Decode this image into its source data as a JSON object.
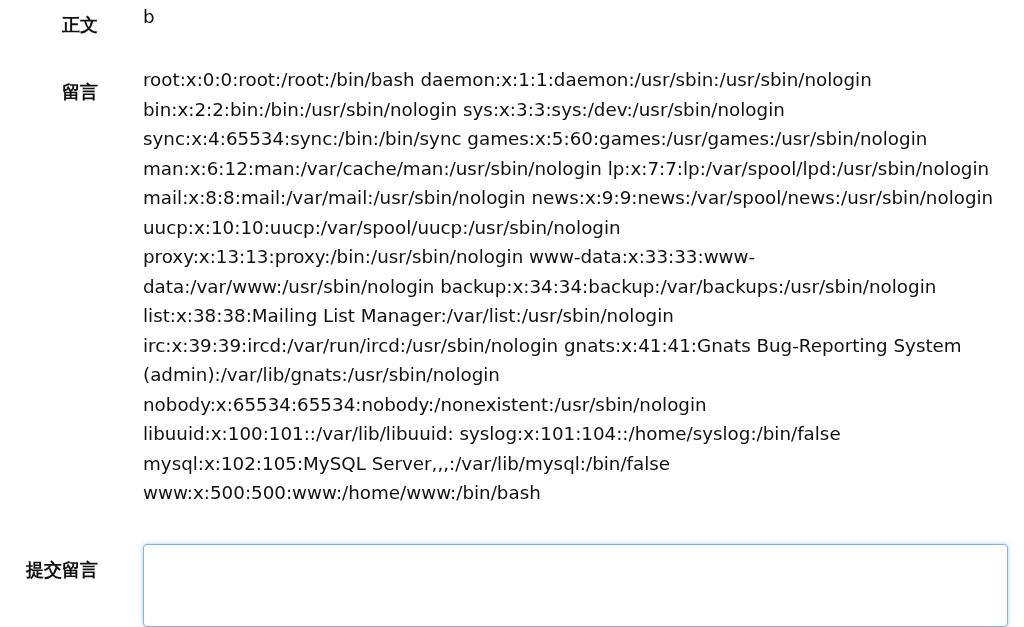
{
  "post": {
    "label": "正文",
    "body": "b"
  },
  "comments": {
    "label": "留言",
    "lines": [
      "root:x:0:0:root:/root:/bin/bash daemon:x:1:1:daemon:/usr/sbin:/usr/sbin/nologin",
      "bin:x:2:2:bin:/bin:/usr/sbin/nologin sys:x:3:3:sys:/dev:/usr/sbin/nologin",
      "sync:x:4:65534:sync:/bin:/bin/sync games:x:5:60:games:/usr/games:/usr/sbin/nologin",
      "man:x:6:12:man:/var/cache/man:/usr/sbin/nologin lp:x:7:7:lp:/var/spool/lpd:/usr/sbin/nologin",
      "mail:x:8:8:mail:/var/mail:/usr/sbin/nologin news:x:9:9:news:/var/spool/news:/usr/sbin/nologin",
      "uucp:x:10:10:uucp:/var/spool/uucp:/usr/sbin/nologin",
      "proxy:x:13:13:proxy:/bin:/usr/sbin/nologin www-data:x:33:33:www-",
      "data:/var/www:/usr/sbin/nologin backup:x:34:34:backup:/var/backups:/usr/sbin/nologin",
      "list:x:38:38:Mailing List Manager:/var/list:/usr/sbin/nologin",
      "irc:x:39:39:ircd:/var/run/ircd:/usr/sbin/nologin gnats:x:41:41:Gnats Bug-Reporting System",
      "(admin):/var/lib/gnats:/usr/sbin/nologin",
      "nobody:x:65534:65534:nobody:/nonexistent:/usr/sbin/nologin",
      "libuuid:x:100:101::/var/lib/libuuid: syslog:x:101:104::/home/syslog:/bin/false",
      "mysql:x:102:105:MySQL Server,,,:/var/lib/mysql:/bin/false",
      "www:x:500:500:www:/home/www:/bin/bash"
    ]
  },
  "comment_form": {
    "label": "提交留言"
  }
}
